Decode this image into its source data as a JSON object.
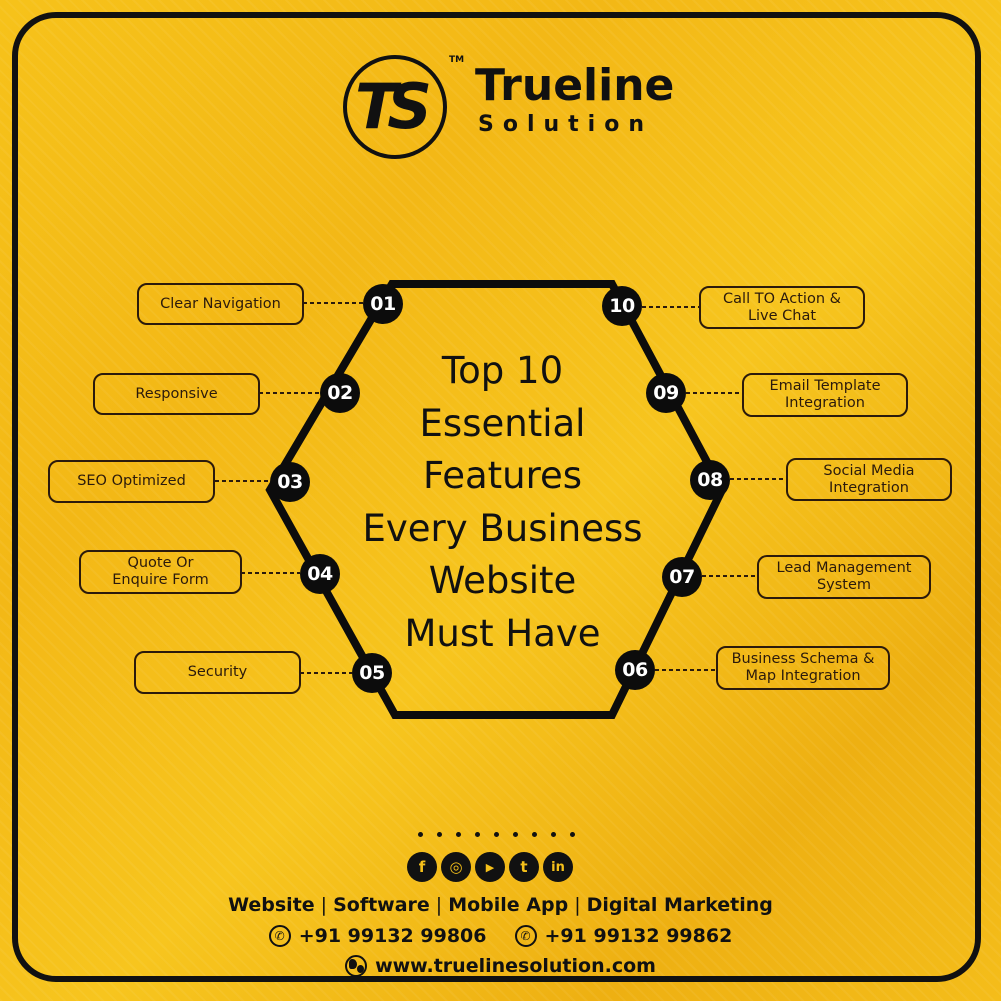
{
  "brand": {
    "logo_mark": "TS",
    "trademark": "TM",
    "name": "Trueline",
    "sub": "Solution"
  },
  "headline": {
    "lines": [
      "Top 10",
      "Essential",
      "Features",
      "Every Business",
      "Website",
      "Must Have"
    ]
  },
  "features": [
    {
      "number": "01",
      "line1": "Clear Navigation",
      "line2": ""
    },
    {
      "number": "02",
      "line1": "Responsive",
      "line2": ""
    },
    {
      "number": "03",
      "line1": "SEO Optimized",
      "line2": ""
    },
    {
      "number": "04",
      "line1": "Quote Or",
      "line2": "Enquire Form"
    },
    {
      "number": "05",
      "line1": "Security",
      "line2": ""
    },
    {
      "number": "06",
      "line1": "Business Schema &",
      "line2": "Map Integration"
    },
    {
      "number": "07",
      "line1": "Lead Management",
      "line2": "System"
    },
    {
      "number": "08",
      "line1": "Social Media",
      "line2": "Integration"
    },
    {
      "number": "09",
      "line1": "Email Template",
      "line2": "Integration"
    },
    {
      "number": "10",
      "line1": "Call TO Action &",
      "line2": "Live Chat"
    }
  ],
  "social": [
    {
      "name": "facebook",
      "glyph": "f"
    },
    {
      "name": "instagram",
      "glyph": "◎"
    },
    {
      "name": "youtube",
      "glyph": "▶"
    },
    {
      "name": "twitter",
      "glyph": "t"
    },
    {
      "name": "linkedin",
      "glyph": "in"
    }
  ],
  "footer": {
    "services": [
      "Website",
      "Software",
      "Mobile App",
      "Digital Marketing"
    ],
    "separator": "|",
    "phones": [
      "+91 99132 99806",
      "+91 99132 99862"
    ],
    "website": "www.truelinesolution.com"
  },
  "colors": {
    "background": "#f5c01a",
    "ink": "#111111",
    "label_border": "#2b1a0c",
    "node_text": "#ffffff"
  }
}
